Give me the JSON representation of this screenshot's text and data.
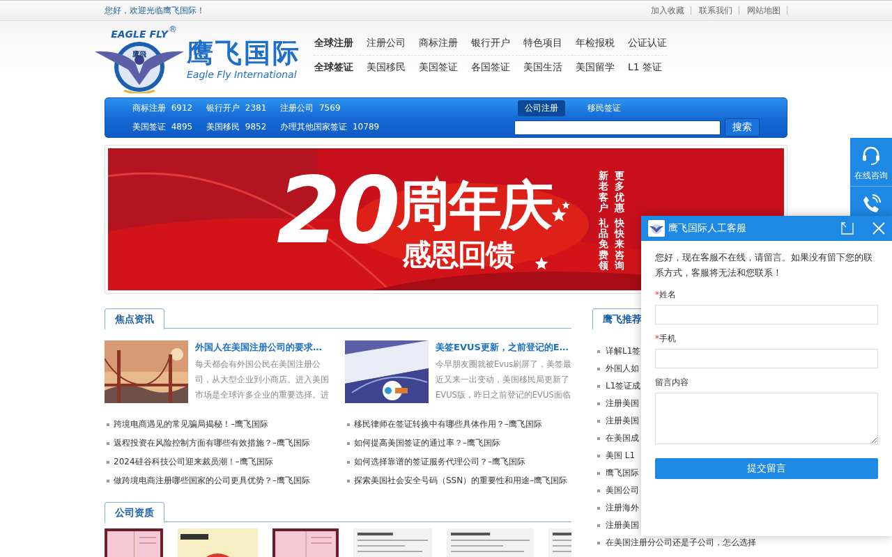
{
  "top_bar": {
    "welcome": "您好，欢迎光临鹰飞国际！",
    "links": [
      "加入收藏",
      "联系我们",
      "网站地图"
    ]
  },
  "logo": {
    "badge_text": "EAGLE FLY",
    "badge_mark": "®",
    "badge_inner": "鷹飛",
    "name": "鹰飞国际",
    "name_en": "Eagle Fly International"
  },
  "nav": [
    {
      "title": "全球注册",
      "items": [
        "注册公司",
        "商标注册",
        "银行开户",
        "特色项目",
        "年检报税",
        "公证认证"
      ]
    },
    {
      "title": "全球签证",
      "items": [
        "美国移民",
        "美国签证",
        "各国签证",
        "美国生活",
        "美国留学",
        "L1 签证"
      ]
    }
  ],
  "stats_bar": {
    "stats": [
      {
        "label": "商标注册",
        "count": "6912"
      },
      {
        "label": "银行开户",
        "count": "2381"
      },
      {
        "label": "注册公司",
        "count": "7569"
      },
      {
        "label": "美国签证",
        "count": "4895"
      },
      {
        "label": "美国移民",
        "count": "9852"
      },
      {
        "label": "办理其他国家签证",
        "count": "10789"
      }
    ],
    "search_tabs": [
      {
        "label": "公司注册",
        "selected": true
      },
      {
        "label": "移民签证",
        "selected": false
      }
    ],
    "search_button": "搜索"
  },
  "banner": {
    "number": "20",
    "title": "周年庆",
    "subtitle": "感恩回馈",
    "columns": [
      {
        "lines": [
          "新老客户",
          "礼品免费领"
        ]
      },
      {
        "lines": [
          "更多优惠",
          "快快来咨询"
        ]
      }
    ]
  },
  "focus_news": {
    "title": "焦点资讯",
    "features": [
      {
        "title": "外国人在美国注册公司的要求…",
        "excerpt": "每天都会有外国公民在美国注册公司，从大型企业到小商店。进入美国市场是全球许多企业的重要选择。进"
      },
      {
        "title": "美签EVUS更新，之前登记的E…",
        "excerpt": "今早朋友圈就被Evus刷屏了，美签最近又来一出变动，美国移民局更新了EVUS版，昨日之前登记的EVUS面临"
      }
    ],
    "links": [
      "跨境电商遇见的常见骗局揭秘！–鹰飞国际",
      "移民律师在签证转换中有哪些具体作用？–鹰飞国际",
      "返程投资在风险控制方面有哪些有效措施？–鹰飞国际",
      "如何提高美国签证的通过率？–鹰飞国际",
      "2024硅谷科技公司迎来裁员潮！–鹰飞国际",
      "如何选择靠谱的签证服务代理公司？–鹰飞国际",
      "做跨境电商注册哪些国家的公司更具优势？–鹰飞国际",
      "探索美国社会安全号码（SSN）的重要性和用途–鹰飞国际"
    ]
  },
  "qualifications": {
    "title": "公司资质",
    "certificates": [
      {
        "kind": "pink"
      },
      {
        "kind": "emblem"
      },
      {
        "kind": "pink"
      },
      {
        "kind": "doc"
      },
      {
        "kind": "doc"
      },
      {
        "kind": "doc"
      }
    ]
  },
  "recommend": {
    "title": "鹰飞推荐",
    "items": [
      "详解L1签",
      "外国人如",
      "L1签证成",
      "注册美国",
      "注册美国",
      "在美国成",
      "美国 L1",
      "鹰飞国际",
      "美国公司",
      "注册海外",
      "注册美国",
      "在美国注册分公司还是子公司，怎么选择"
    ]
  },
  "float_bar": {
    "items": [
      {
        "kind": "headset",
        "label": "在线咨询"
      },
      {
        "kind": "phone"
      }
    ]
  },
  "chat": {
    "title": "鹰飞国际人工客服",
    "notice": "您好，现在客服不在线，请留言。如果没有留下您的联系方式，客服将无法和您联系！",
    "fields": [
      {
        "label": "姓名",
        "marker": "*",
        "kind": "input"
      },
      {
        "label": "手机",
        "marker": "*",
        "kind": "input"
      },
      {
        "label": "留言内容",
        "kind": "textarea"
      }
    ],
    "submit": "提交留言"
  }
}
